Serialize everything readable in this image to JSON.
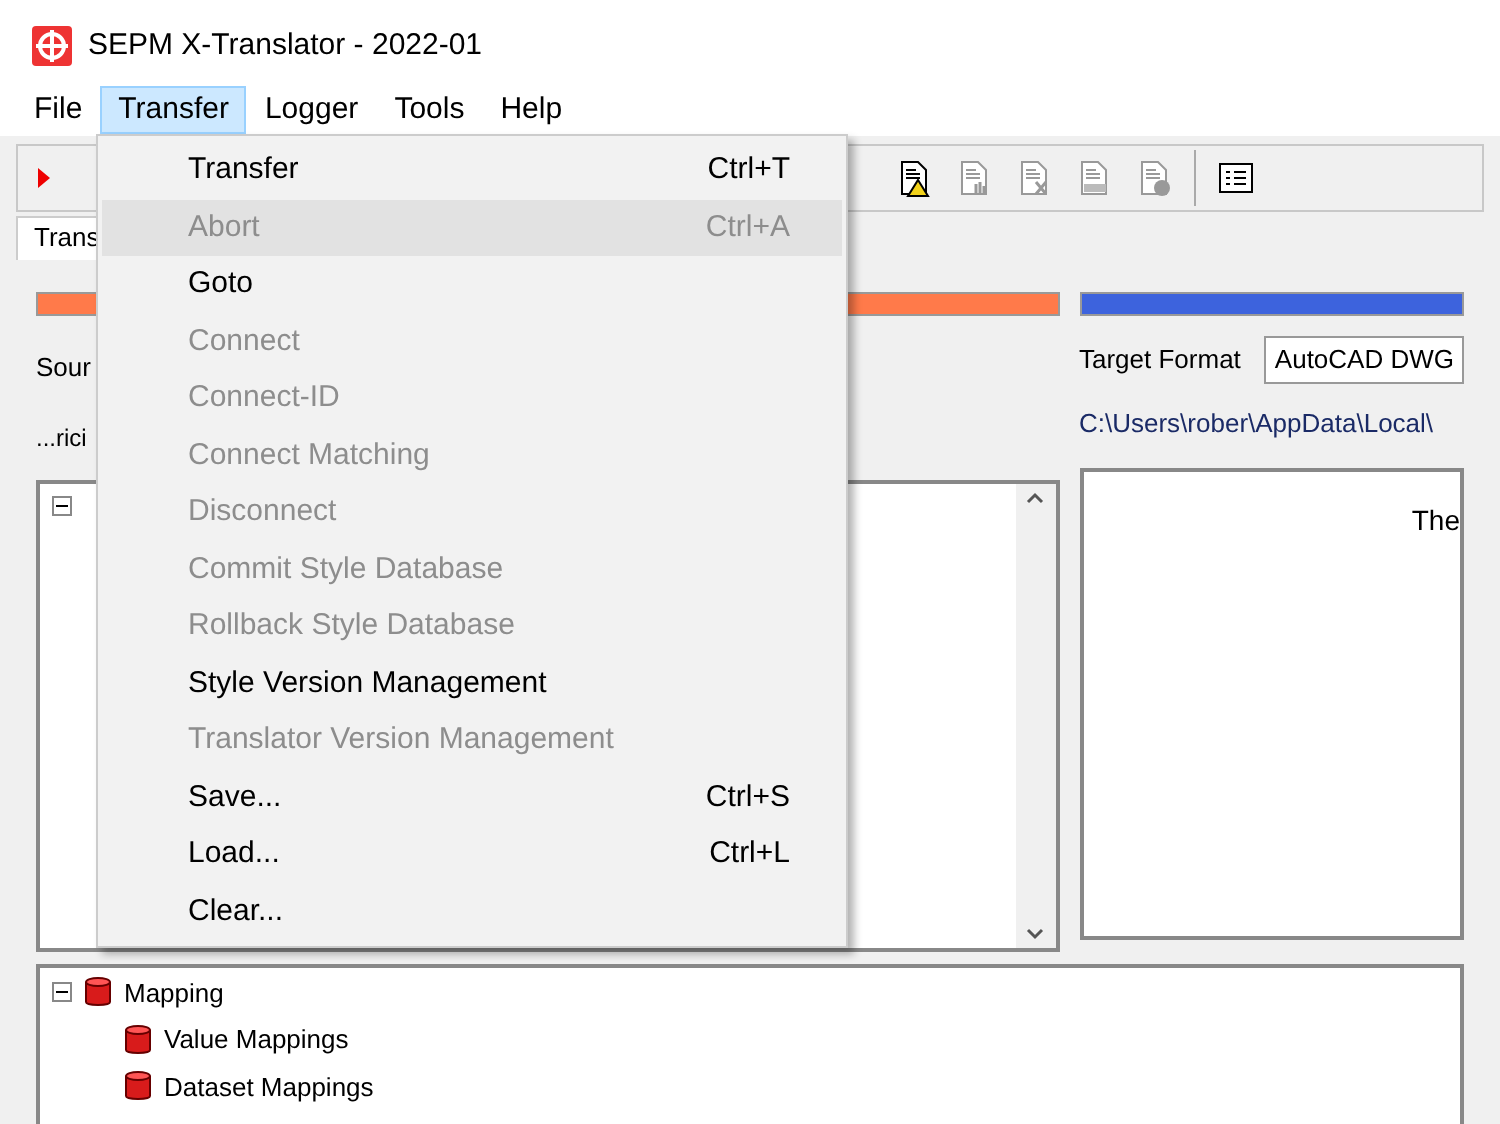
{
  "window": {
    "title": "SEPM X-Translator - 2022-01"
  },
  "menu_bar": [
    {
      "label": "File",
      "selected": false
    },
    {
      "label": "Transfer",
      "selected": true
    },
    {
      "label": "Logger",
      "selected": false
    },
    {
      "label": "Tools",
      "selected": false
    },
    {
      "label": "Help",
      "selected": false
    }
  ],
  "tab": {
    "label": "Trans"
  },
  "source": {
    "label": "Sour",
    "path": "...rici",
    "level": 1
  },
  "target": {
    "level": 1,
    "label": "Target Format",
    "format": "AutoCAD DWG",
    "path": "C:\\Users\\rober\\AppData\\Local\\"
  },
  "preview": {
    "text": "The"
  },
  "mapping_tree": [
    {
      "label": "Mapping",
      "expanded": true,
      "children": [
        {
          "label": "Value Mappings"
        },
        {
          "label": "Dataset Mappings"
        }
      ]
    }
  ],
  "transfer_menu": [
    {
      "label": "Transfer",
      "shortcut": "Ctrl+T",
      "disabled": false,
      "selected": false
    },
    {
      "label": "Abort",
      "shortcut": "Ctrl+A",
      "disabled": true,
      "selected": true
    },
    {
      "label": "Goto",
      "disabled": false,
      "selected": false
    },
    {
      "label": "Connect",
      "disabled": true,
      "selected": false
    },
    {
      "label": "Connect-ID",
      "disabled": true,
      "selected": false
    },
    {
      "label": "Connect Matching",
      "disabled": true,
      "selected": false
    },
    {
      "label": "Disconnect",
      "disabled": true,
      "selected": false
    },
    {
      "label": "Commit Style Database",
      "disabled": true,
      "selected": false
    },
    {
      "label": "Rollback Style Database",
      "disabled": true,
      "selected": false
    },
    {
      "label": "Style Version Management",
      "disabled": false,
      "selected": false
    },
    {
      "label": "Translator Version Management",
      "disabled": true,
      "selected": false
    },
    {
      "label": "Save...",
      "shortcut": "Ctrl+S",
      "disabled": false,
      "selected": false
    },
    {
      "label": "Load...",
      "shortcut": "Ctrl+L",
      "disabled": false,
      "selected": false
    },
    {
      "label": "Clear...",
      "disabled": false,
      "selected": false
    }
  ]
}
